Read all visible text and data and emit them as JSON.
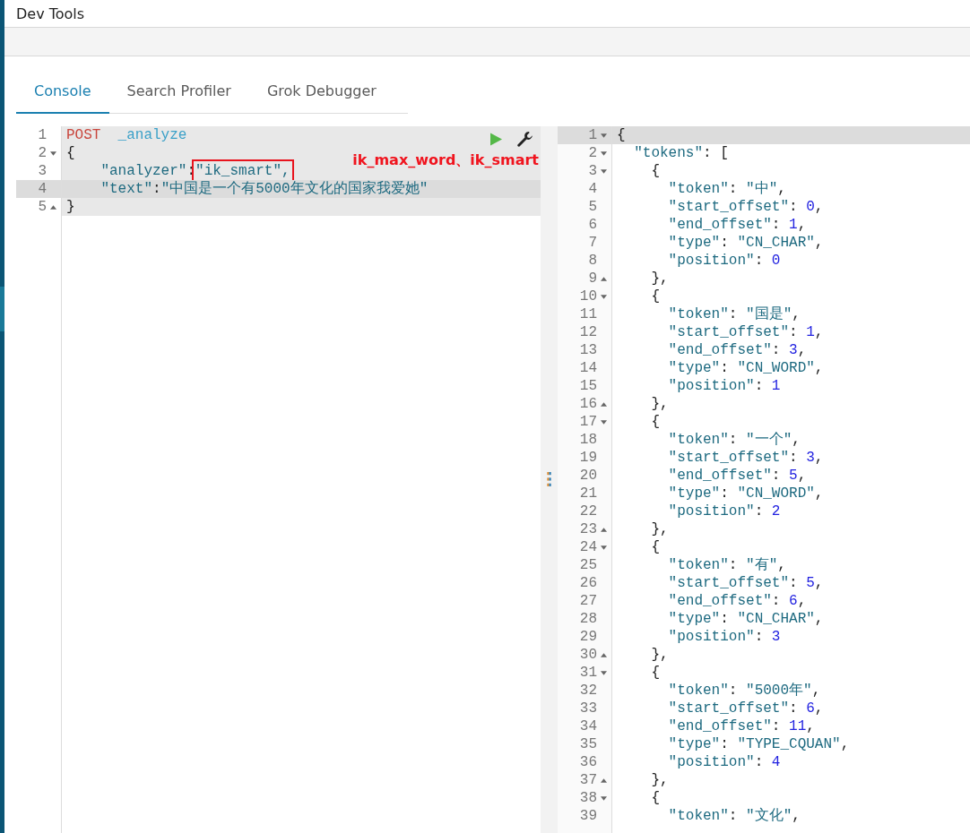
{
  "window": {
    "title": "Dev Tools"
  },
  "tabs": [
    {
      "label": "Console",
      "selected": true
    },
    {
      "label": "Search Profiler",
      "selected": false
    },
    {
      "label": "Grok Debugger",
      "selected": false
    }
  ],
  "request_editor": {
    "annotation": "ik_max_word、ik_smart",
    "lines": [
      {
        "number": "1",
        "kind": "plain",
        "active": false,
        "parts": [
          {
            "kind": "method",
            "text": "POST"
          },
          {
            "kind": "url",
            "text": "_analyze"
          }
        ]
      },
      {
        "number": "2",
        "kind": "opener",
        "active": false,
        "parts": [
          {
            "kind": "punct",
            "text": "{"
          }
        ]
      },
      {
        "number": "3",
        "kind": "plain",
        "active": false,
        "parts": [
          {
            "kind": "key",
            "text": "    \"analyzer\""
          },
          {
            "kind": "punct",
            "text": ":"
          },
          {
            "kind": "string",
            "text": "\"ik_smart\",",
            "boxed": true
          }
        ]
      },
      {
        "number": "4",
        "kind": "plain",
        "active": true,
        "parts": [
          {
            "kind": "key",
            "text": "    \"text\""
          },
          {
            "kind": "punct",
            "text": ":"
          },
          {
            "kind": "string",
            "text": "\"中国是一个有5000年文化的国家我爱她\""
          }
        ]
      },
      {
        "number": "5",
        "kind": "closer",
        "active": false,
        "parts": [
          {
            "kind": "punct",
            "text": "}"
          }
        ]
      }
    ]
  },
  "response_editor": {
    "lines": [
      {
        "number": "1",
        "kind": "opener",
        "active": true,
        "parts": [
          {
            "kind": "punct",
            "text": "{"
          }
        ]
      },
      {
        "number": "2",
        "kind": "opener",
        "active": false,
        "parts": [
          {
            "kind": "key",
            "text": "  \"tokens\""
          },
          {
            "kind": "punct",
            "text": ": ["
          }
        ]
      },
      {
        "number": "3",
        "kind": "opener",
        "active": false,
        "parts": [
          {
            "kind": "punct",
            "text": "    {"
          }
        ]
      },
      {
        "number": "4",
        "kind": "plain",
        "active": false,
        "parts": [
          {
            "kind": "key",
            "text": "      \"token\""
          },
          {
            "kind": "punct",
            "text": ": "
          },
          {
            "kind": "string",
            "text": "\"中\""
          },
          {
            "kind": "punct",
            "text": ","
          }
        ]
      },
      {
        "number": "5",
        "kind": "plain",
        "active": false,
        "parts": [
          {
            "kind": "key",
            "text": "      \"start_offset\""
          },
          {
            "kind": "punct",
            "text": ": "
          },
          {
            "kind": "number",
            "text": "0"
          },
          {
            "kind": "punct",
            "text": ","
          }
        ]
      },
      {
        "number": "6",
        "kind": "plain",
        "active": false,
        "parts": [
          {
            "kind": "key",
            "text": "      \"end_offset\""
          },
          {
            "kind": "punct",
            "text": ": "
          },
          {
            "kind": "number",
            "text": "1"
          },
          {
            "kind": "punct",
            "text": ","
          }
        ]
      },
      {
        "number": "7",
        "kind": "plain",
        "active": false,
        "parts": [
          {
            "kind": "key",
            "text": "      \"type\""
          },
          {
            "kind": "punct",
            "text": ": "
          },
          {
            "kind": "string",
            "text": "\"CN_CHAR\""
          },
          {
            "kind": "punct",
            "text": ","
          }
        ]
      },
      {
        "number": "8",
        "kind": "plain",
        "active": false,
        "parts": [
          {
            "kind": "key",
            "text": "      \"position\""
          },
          {
            "kind": "punct",
            "text": ": "
          },
          {
            "kind": "number",
            "text": "0"
          }
        ]
      },
      {
        "number": "9",
        "kind": "closer",
        "active": false,
        "parts": [
          {
            "kind": "punct",
            "text": "    },"
          }
        ]
      },
      {
        "number": "10",
        "kind": "opener",
        "active": false,
        "parts": [
          {
            "kind": "punct",
            "text": "    {"
          }
        ]
      },
      {
        "number": "11",
        "kind": "plain",
        "active": false,
        "parts": [
          {
            "kind": "key",
            "text": "      \"token\""
          },
          {
            "kind": "punct",
            "text": ": "
          },
          {
            "kind": "string",
            "text": "\"国是\""
          },
          {
            "kind": "punct",
            "text": ","
          }
        ]
      },
      {
        "number": "12",
        "kind": "plain",
        "active": false,
        "parts": [
          {
            "kind": "key",
            "text": "      \"start_offset\""
          },
          {
            "kind": "punct",
            "text": ": "
          },
          {
            "kind": "number",
            "text": "1"
          },
          {
            "kind": "punct",
            "text": ","
          }
        ]
      },
      {
        "number": "13",
        "kind": "plain",
        "active": false,
        "parts": [
          {
            "kind": "key",
            "text": "      \"end_offset\""
          },
          {
            "kind": "punct",
            "text": ": "
          },
          {
            "kind": "number",
            "text": "3"
          },
          {
            "kind": "punct",
            "text": ","
          }
        ]
      },
      {
        "number": "14",
        "kind": "plain",
        "active": false,
        "parts": [
          {
            "kind": "key",
            "text": "      \"type\""
          },
          {
            "kind": "punct",
            "text": ": "
          },
          {
            "kind": "string",
            "text": "\"CN_WORD\""
          },
          {
            "kind": "punct",
            "text": ","
          }
        ]
      },
      {
        "number": "15",
        "kind": "plain",
        "active": false,
        "parts": [
          {
            "kind": "key",
            "text": "      \"position\""
          },
          {
            "kind": "punct",
            "text": ": "
          },
          {
            "kind": "number",
            "text": "1"
          }
        ]
      },
      {
        "number": "16",
        "kind": "closer",
        "active": false,
        "parts": [
          {
            "kind": "punct",
            "text": "    },"
          }
        ]
      },
      {
        "number": "17",
        "kind": "opener",
        "active": false,
        "parts": [
          {
            "kind": "punct",
            "text": "    {"
          }
        ]
      },
      {
        "number": "18",
        "kind": "plain",
        "active": false,
        "parts": [
          {
            "kind": "key",
            "text": "      \"token\""
          },
          {
            "kind": "punct",
            "text": ": "
          },
          {
            "kind": "string",
            "text": "\"一个\""
          },
          {
            "kind": "punct",
            "text": ","
          }
        ]
      },
      {
        "number": "19",
        "kind": "plain",
        "active": false,
        "parts": [
          {
            "kind": "key",
            "text": "      \"start_offset\""
          },
          {
            "kind": "punct",
            "text": ": "
          },
          {
            "kind": "number",
            "text": "3"
          },
          {
            "kind": "punct",
            "text": ","
          }
        ]
      },
      {
        "number": "20",
        "kind": "plain",
        "active": false,
        "parts": [
          {
            "kind": "key",
            "text": "      \"end_offset\""
          },
          {
            "kind": "punct",
            "text": ": "
          },
          {
            "kind": "number",
            "text": "5"
          },
          {
            "kind": "punct",
            "text": ","
          }
        ]
      },
      {
        "number": "21",
        "kind": "plain",
        "active": false,
        "parts": [
          {
            "kind": "key",
            "text": "      \"type\""
          },
          {
            "kind": "punct",
            "text": ": "
          },
          {
            "kind": "string",
            "text": "\"CN_WORD\""
          },
          {
            "kind": "punct",
            "text": ","
          }
        ]
      },
      {
        "number": "22",
        "kind": "plain",
        "active": false,
        "parts": [
          {
            "kind": "key",
            "text": "      \"position\""
          },
          {
            "kind": "punct",
            "text": ": "
          },
          {
            "kind": "number",
            "text": "2"
          }
        ]
      },
      {
        "number": "23",
        "kind": "closer",
        "active": false,
        "parts": [
          {
            "kind": "punct",
            "text": "    },"
          }
        ]
      },
      {
        "number": "24",
        "kind": "opener",
        "active": false,
        "parts": [
          {
            "kind": "punct",
            "text": "    {"
          }
        ]
      },
      {
        "number": "25",
        "kind": "plain",
        "active": false,
        "parts": [
          {
            "kind": "key",
            "text": "      \"token\""
          },
          {
            "kind": "punct",
            "text": ": "
          },
          {
            "kind": "string",
            "text": "\"有\""
          },
          {
            "kind": "punct",
            "text": ","
          }
        ]
      },
      {
        "number": "26",
        "kind": "plain",
        "active": false,
        "parts": [
          {
            "kind": "key",
            "text": "      \"start_offset\""
          },
          {
            "kind": "punct",
            "text": ": "
          },
          {
            "kind": "number",
            "text": "5"
          },
          {
            "kind": "punct",
            "text": ","
          }
        ]
      },
      {
        "number": "27",
        "kind": "plain",
        "active": false,
        "parts": [
          {
            "kind": "key",
            "text": "      \"end_offset\""
          },
          {
            "kind": "punct",
            "text": ": "
          },
          {
            "kind": "number",
            "text": "6"
          },
          {
            "kind": "punct",
            "text": ","
          }
        ]
      },
      {
        "number": "28",
        "kind": "plain",
        "active": false,
        "parts": [
          {
            "kind": "key",
            "text": "      \"type\""
          },
          {
            "kind": "punct",
            "text": ": "
          },
          {
            "kind": "string",
            "text": "\"CN_CHAR\""
          },
          {
            "kind": "punct",
            "text": ","
          }
        ]
      },
      {
        "number": "29",
        "kind": "plain",
        "active": false,
        "parts": [
          {
            "kind": "key",
            "text": "      \"position\""
          },
          {
            "kind": "punct",
            "text": ": "
          },
          {
            "kind": "number",
            "text": "3"
          }
        ]
      },
      {
        "number": "30",
        "kind": "closer",
        "active": false,
        "parts": [
          {
            "kind": "punct",
            "text": "    },"
          }
        ]
      },
      {
        "number": "31",
        "kind": "opener",
        "active": false,
        "parts": [
          {
            "kind": "punct",
            "text": "    {"
          }
        ]
      },
      {
        "number": "32",
        "kind": "plain",
        "active": false,
        "parts": [
          {
            "kind": "key",
            "text": "      \"token\""
          },
          {
            "kind": "punct",
            "text": ": "
          },
          {
            "kind": "string",
            "text": "\"5000年\""
          },
          {
            "kind": "punct",
            "text": ","
          }
        ]
      },
      {
        "number": "33",
        "kind": "plain",
        "active": false,
        "parts": [
          {
            "kind": "key",
            "text": "      \"start_offset\""
          },
          {
            "kind": "punct",
            "text": ": "
          },
          {
            "kind": "number",
            "text": "6"
          },
          {
            "kind": "punct",
            "text": ","
          }
        ]
      },
      {
        "number": "34",
        "kind": "plain",
        "active": false,
        "parts": [
          {
            "kind": "key",
            "text": "      \"end_offset\""
          },
          {
            "kind": "punct",
            "text": ": "
          },
          {
            "kind": "number",
            "text": "11"
          },
          {
            "kind": "punct",
            "text": ","
          }
        ]
      },
      {
        "number": "35",
        "kind": "plain",
        "active": false,
        "parts": [
          {
            "kind": "key",
            "text": "      \"type\""
          },
          {
            "kind": "punct",
            "text": ": "
          },
          {
            "kind": "string",
            "text": "\"TYPE_CQUAN\""
          },
          {
            "kind": "punct",
            "text": ","
          }
        ]
      },
      {
        "number": "36",
        "kind": "plain",
        "active": false,
        "parts": [
          {
            "kind": "key",
            "text": "      \"position\""
          },
          {
            "kind": "punct",
            "text": ": "
          },
          {
            "kind": "number",
            "text": "4"
          }
        ]
      },
      {
        "number": "37",
        "kind": "closer",
        "active": false,
        "parts": [
          {
            "kind": "punct",
            "text": "    },"
          }
        ]
      },
      {
        "number": "38",
        "kind": "opener",
        "active": false,
        "parts": [
          {
            "kind": "punct",
            "text": "    {"
          }
        ]
      },
      {
        "number": "39",
        "kind": "plain",
        "active": false,
        "parts": [
          {
            "kind": "key",
            "text": "      \"token\""
          },
          {
            "kind": "punct",
            "text": ": "
          },
          {
            "kind": "string",
            "text": "\"文化\""
          },
          {
            "kind": "punct",
            "text": ","
          }
        ]
      }
    ]
  }
}
